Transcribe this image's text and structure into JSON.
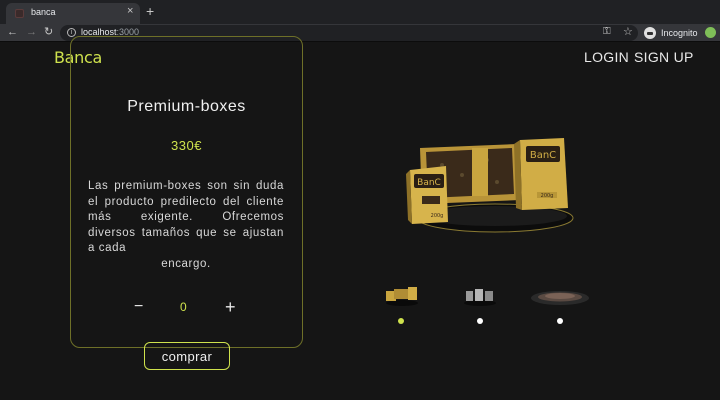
{
  "browser": {
    "tab_title": "banca",
    "tab_close": "×",
    "new_tab": "+",
    "url_host": "localhost",
    "url_port": ":3000",
    "profile_label": "Incognito"
  },
  "header": {
    "logo": "Banca",
    "login": "LOGIN",
    "signup": "SIGN UP"
  },
  "product": {
    "title": "Premium-boxes",
    "price": "330€",
    "description_main": "Las premium-boxes son sin duda el producto predilecto del cliente más exigente. Ofrecemos diversos tamaños que se ajustan a cada",
    "description_last": "encargo.",
    "quantity": "0",
    "minus": "−",
    "plus": "+",
    "buy_label": "comprar",
    "box_label": "BanC",
    "box_weight": "200g"
  },
  "gallery": {
    "images": [
      "premium-boxes",
      "silver-molds",
      "chocolate-tray"
    ],
    "active_index": 0
  },
  "colors": {
    "accent": "#cfe24d",
    "background": "#151515",
    "card_border": "#6e7028",
    "gold": "#c9a53f"
  }
}
